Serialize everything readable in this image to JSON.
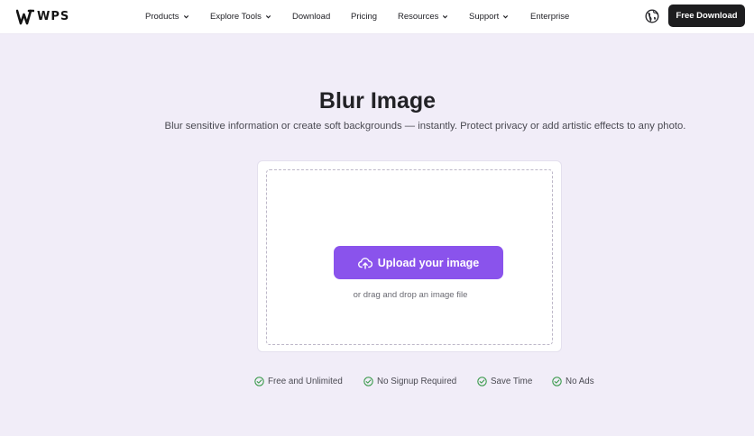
{
  "nav": {
    "logo_text": "WPS",
    "items": [
      {
        "label": "Products",
        "dropdown": true
      },
      {
        "label": "Explore Tools",
        "dropdown": true
      },
      {
        "label": "Download",
        "dropdown": false
      },
      {
        "label": "Pricing",
        "dropdown": false
      },
      {
        "label": "Resources",
        "dropdown": true
      },
      {
        "label": "Support",
        "dropdown": true
      },
      {
        "label": "Enterprise",
        "dropdown": false
      }
    ],
    "globe_icon": "globe-icon",
    "cta_label": "Free Download"
  },
  "hero": {
    "title": "Blur Image",
    "subtitle": "Blur sensitive information or create soft backgrounds — instantly. Protect privacy or add artistic effects to any photo."
  },
  "upload": {
    "button_label": "Upload your image",
    "button_icon": "cloud-upload-icon",
    "drag_hint": "or drag and drop an image file"
  },
  "features": [
    {
      "label": "Free and Unlimited",
      "icon": "check-circle-icon"
    },
    {
      "label": "No Signup Required",
      "icon": "check-circle-icon"
    },
    {
      "label": "Save Time",
      "icon": "check-circle-icon"
    },
    {
      "label": "No Ads",
      "icon": "check-circle-icon"
    }
  ],
  "colors": {
    "page_bg": "#f1edf8",
    "accent": "#8a53ec",
    "cta_bg": "#1d1d1f",
    "check_green": "#3a9a4b"
  }
}
